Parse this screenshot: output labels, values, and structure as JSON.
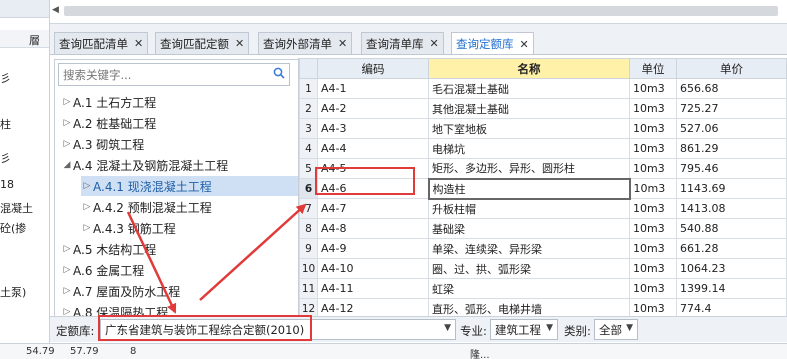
{
  "left_panel": {
    "header": "層",
    "fragments": [
      "彡",
      "柱",
      "彡",
      "18",
      "混凝土",
      "砼(掺",
      "土泵)"
    ]
  },
  "tabs": [
    {
      "label": "查询匹配清单",
      "active": false
    },
    {
      "label": "查询匹配定额",
      "active": false
    },
    {
      "label": "查询外部清单",
      "active": false
    },
    {
      "label": "查询清单库",
      "active": false
    },
    {
      "label": "查询定额库",
      "active": true
    }
  ],
  "search": {
    "placeholder": "搜索关键字..."
  },
  "tree": [
    {
      "label": "A.1 土石方工程",
      "expanded": false,
      "level": 0
    },
    {
      "label": "A.2 桩基础工程",
      "expanded": false,
      "level": 0
    },
    {
      "label": "A.3 砌筑工程",
      "expanded": false,
      "level": 0
    },
    {
      "label": "A.4 混凝土及钢筋混凝土工程",
      "expanded": true,
      "level": 0
    },
    {
      "label": "A.4.1 现浇混凝土工程",
      "expanded": false,
      "level": 1,
      "selected": true
    },
    {
      "label": "A.4.2 预制混凝土工程",
      "expanded": false,
      "level": 1
    },
    {
      "label": "A.4.3 钢筋工程",
      "expanded": false,
      "level": 1
    },
    {
      "label": "A.5 木结构工程",
      "expanded": false,
      "level": 0
    },
    {
      "label": "A.6 金属工程",
      "expanded": false,
      "level": 0
    },
    {
      "label": "A.7 屋面及防水工程",
      "expanded": false,
      "level": 0
    },
    {
      "label": "A.8 保温隔热工程",
      "expanded": false,
      "level": 0
    }
  ],
  "table": {
    "columns": [
      "编码",
      "名称",
      "单位",
      "单价"
    ],
    "rows": [
      {
        "n": "1",
        "code": "A4-1",
        "name": "毛石混凝土基础",
        "unit": "10m3",
        "price": "656.68"
      },
      {
        "n": "2",
        "code": "A4-2",
        "name": "其他混凝土基础",
        "unit": "10m3",
        "price": "725.27"
      },
      {
        "n": "3",
        "code": "A4-3",
        "name": "地下室地板",
        "unit": "10m3",
        "price": "527.06"
      },
      {
        "n": "4",
        "code": "A4-4",
        "name": "电梯坑",
        "unit": "10m3",
        "price": "861.29"
      },
      {
        "n": "5",
        "code": "A4-5",
        "name": "矩形、多边形、异形、圆形柱",
        "unit": "10m3",
        "price": "795.46"
      },
      {
        "n": "6",
        "code": "A4-6",
        "name": "构造柱",
        "unit": "10m3",
        "price": "1143.69",
        "current": true
      },
      {
        "n": "7",
        "code": "A4-7",
        "name": "升板柱帽",
        "unit": "10m3",
        "price": "1413.08"
      },
      {
        "n": "8",
        "code": "A4-8",
        "name": "基础梁",
        "unit": "10m3",
        "price": "540.88"
      },
      {
        "n": "9",
        "code": "A4-9",
        "name": "单梁、连续梁、异形梁",
        "unit": "10m3",
        "price": "661.28"
      },
      {
        "n": "10",
        "code": "A4-10",
        "name": "圈、过、拱、弧形梁",
        "unit": "10m3",
        "price": "1064.23"
      },
      {
        "n": "11",
        "code": "A4-11",
        "name": "虹梁",
        "unit": "10m3",
        "price": "1399.14"
      },
      {
        "n": "12",
        "code": "A4-12",
        "name": "直形、弧形、电梯井墙",
        "unit": "10m3",
        "price": "774.4"
      }
    ]
  },
  "filter": {
    "quota_label": "定额库:",
    "quota_value": "广东省建筑与装饰工程综合定额(2010)",
    "major_label": "专业:",
    "major_value": "建筑工程",
    "category_label": "类别:",
    "category_value": "全部"
  },
  "bottom_fragments": [
    "54.79",
    "57.79",
    "8",
    "隆..."
  ],
  "colors": {
    "annotation": "#e03a3a",
    "active_tab": "#1f6fd1",
    "name_header": "#fff1a8"
  }
}
